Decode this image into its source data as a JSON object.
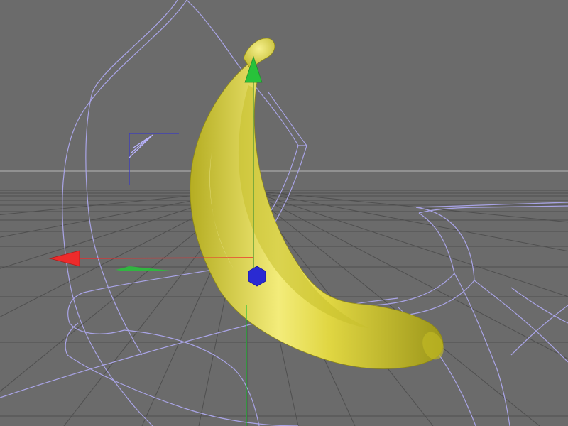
{
  "viewport": {
    "background": "#6b6b6b",
    "horizon_color": "#a8a8a8",
    "grid_color": "#4f4f4f",
    "spline_color": "#a9a4e6"
  },
  "scene": {
    "object": {
      "kind": "banana",
      "color": "#d8cf3a",
      "highlight": "#fbf7b4",
      "shadow": "#8f8a18"
    },
    "gizmo": {
      "x_axis": {
        "color": "#ee2b2b",
        "handle": "arrow"
      },
      "y_axis": {
        "color": "#27c23a",
        "handle": "arrow"
      },
      "z_axis": {
        "color": "#2a2ad2",
        "handle": "hexagon"
      }
    },
    "icons": [
      "banana-model",
      "move-gizmo",
      "deformer-cage",
      "null-object-bracket"
    ]
  }
}
